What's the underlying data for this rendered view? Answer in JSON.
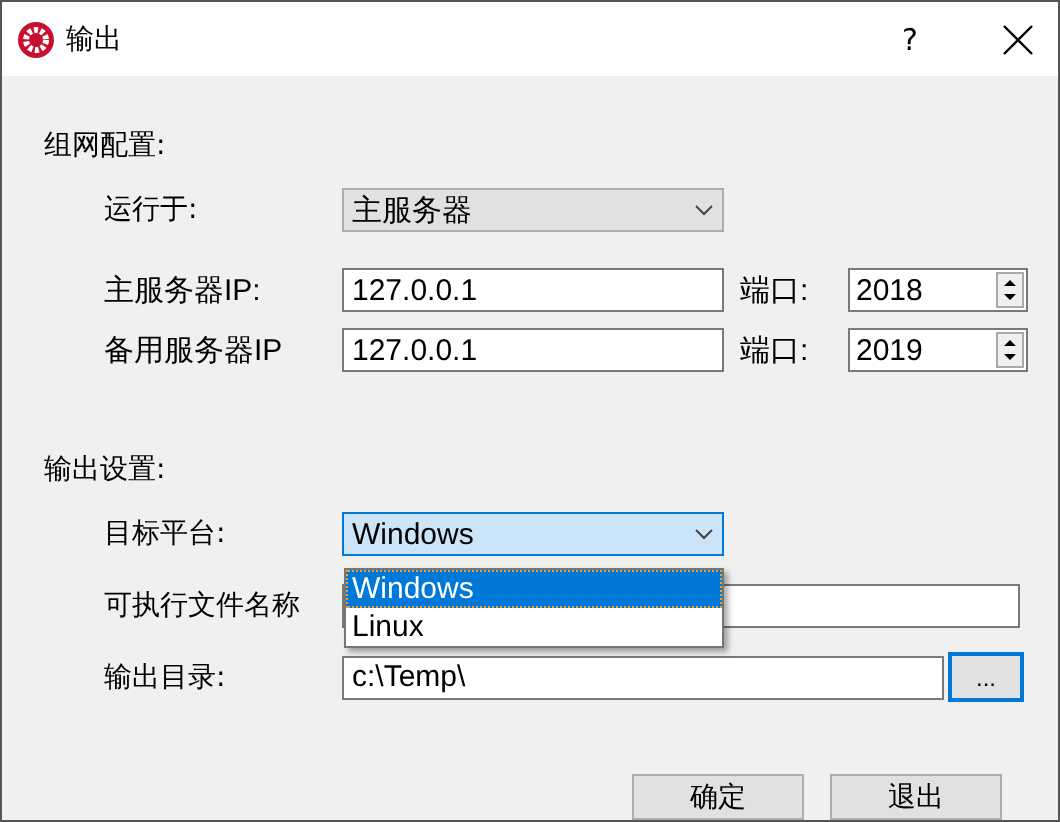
{
  "window": {
    "title": "输出",
    "help": "?"
  },
  "network": {
    "label": "组网配置:",
    "run_on": {
      "label": "运行于:",
      "value": "主服务器"
    },
    "servers": [
      {
        "label": "主服务器IP:",
        "ip": "127.0.0.1",
        "port_label": "端口:",
        "port": "2018"
      },
      {
        "label": "备用服务器IP",
        "ip": "127.0.0.1",
        "port_label": "端口:",
        "port": "2019"
      }
    ]
  },
  "output": {
    "label": "输出设置:",
    "platform": {
      "label": "目标平台:",
      "value": "Windows",
      "expanded": true,
      "options": [
        {
          "label": "Windows",
          "selected": true
        },
        {
          "label": "Linux",
          "selected": false
        }
      ]
    },
    "exe_name": {
      "label": "可执行文件名称"
    },
    "dir": {
      "label": "输出目录:",
      "value": "c:\\Temp\\",
      "browse": "..."
    }
  },
  "buttons": [
    "确定",
    "退出"
  ]
}
